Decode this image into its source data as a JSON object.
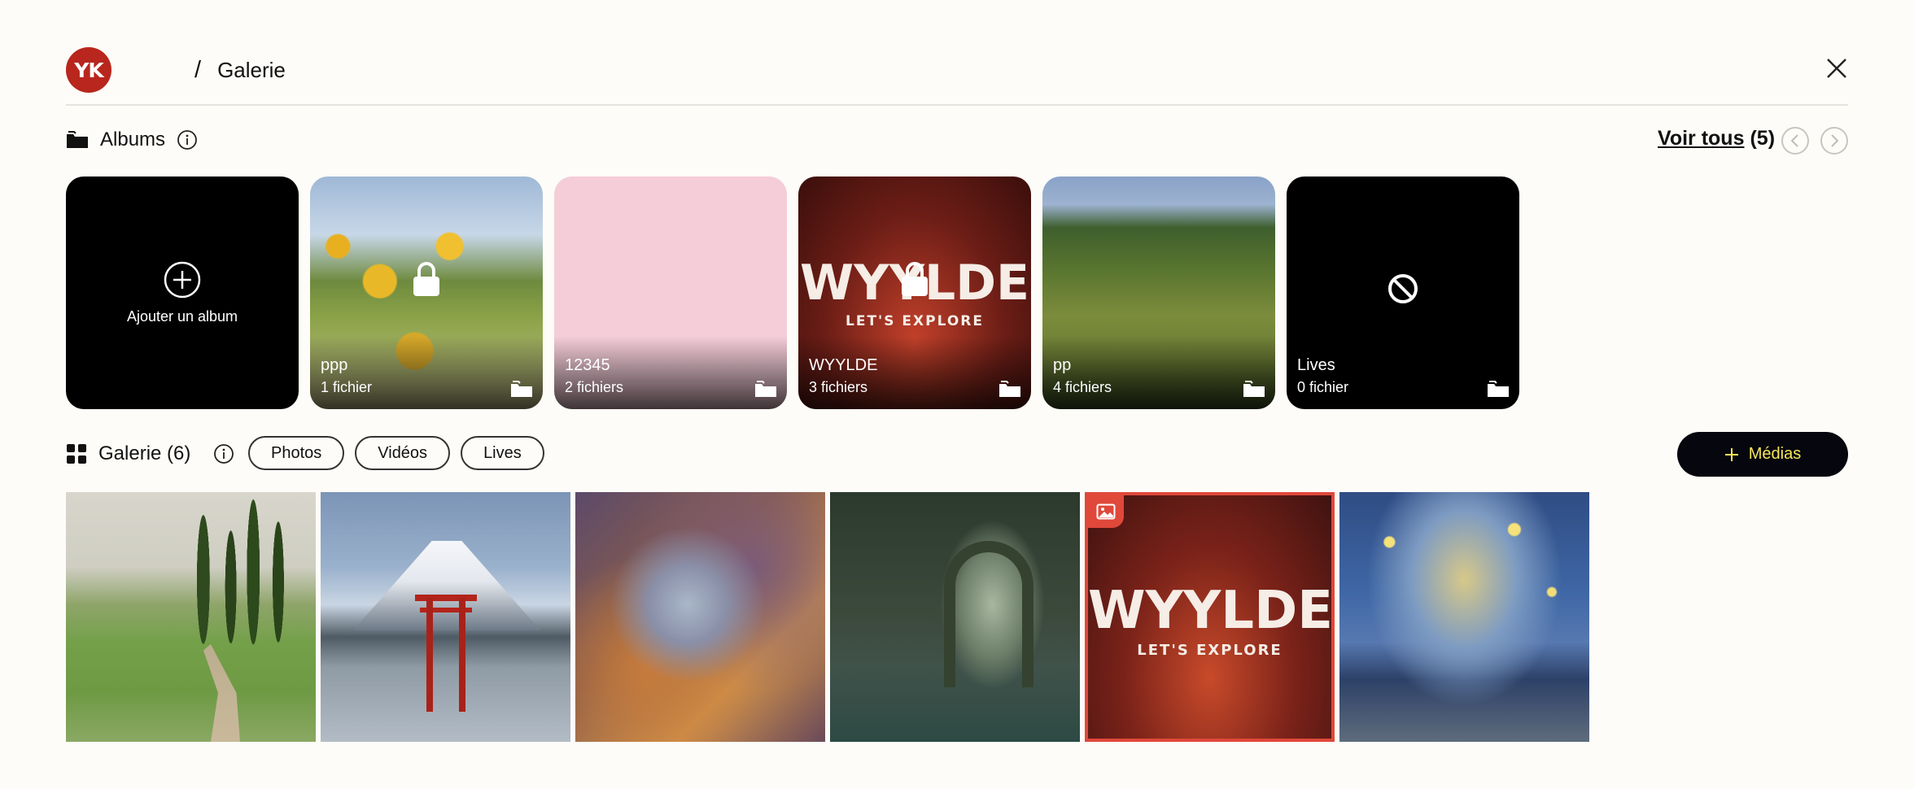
{
  "header": {
    "logo_text": "YK",
    "separator": "/",
    "title": "Galerie"
  },
  "albums_section": {
    "label": "Albums",
    "see_all_label": "Voir tous",
    "see_all_count": "(5)"
  },
  "albums": [
    {
      "type": "add",
      "label": "Ajouter un album"
    },
    {
      "name": "ppp",
      "count": "1 fichier",
      "locked": true
    },
    {
      "name": "12345",
      "count": "2 fichiers",
      "locked": false
    },
    {
      "name": "WYYLDE",
      "count": "3 fichiers",
      "locked": true,
      "image_text": "WYYLDE",
      "image_subtext": "LET'S EXPLORE"
    },
    {
      "name": "pp",
      "count": "4 fichiers",
      "locked": false
    },
    {
      "name": "Lives",
      "count": "0 fichier",
      "locked": false
    }
  ],
  "gallery_section": {
    "label": "Galerie (6)",
    "filters": [
      "Photos",
      "Vidéos",
      "Lives"
    ],
    "add_button": "Médias",
    "selected_tile_text": "WYYLDE",
    "selected_tile_subtext": "LET'S EXPLORE"
  },
  "colors": {
    "logo": "#b8261d",
    "media_button_bg": "#06060e",
    "media_button_text": "#f4e65a",
    "selection": "#e0483a"
  }
}
